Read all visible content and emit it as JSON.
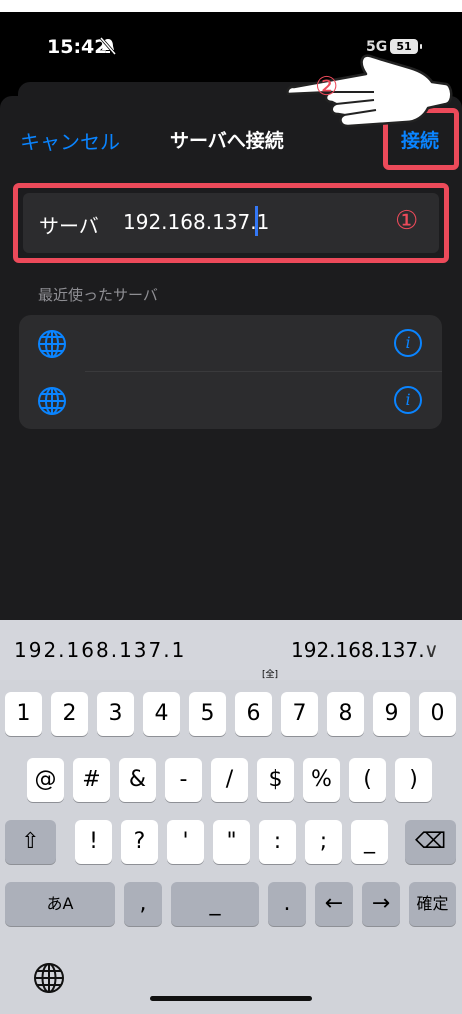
{
  "status_bar": {
    "time": "15:42",
    "network": "5G",
    "battery": "51"
  },
  "header": {
    "cancel_label": "キャンセル",
    "title": "サーバへ接続",
    "connect_label": "接続"
  },
  "server_field": {
    "label": "サーバ",
    "value": "192.168.137.1"
  },
  "recent": {
    "section_label": "最近使ったサーバ",
    "items": [
      {
        "icon": "globe-icon"
      },
      {
        "icon": "globe-icon"
      }
    ]
  },
  "annotations": {
    "step1": "①",
    "step2": "②",
    "highlight_color": "#ec4a5a"
  },
  "keyboard": {
    "candidate_primary": "192.168.137.1",
    "candidate_mark": "[全]",
    "candidate_secondary": "192.168.137.",
    "candidate_more": "∨",
    "row1": [
      "1",
      "2",
      "3",
      "4",
      "5",
      "6",
      "7",
      "8",
      "9",
      "0"
    ],
    "row2": [
      "@",
      "#",
      "&",
      "-",
      "/",
      "$",
      "%",
      "(",
      ")"
    ],
    "row3": [
      "!",
      "?",
      "'",
      "\"",
      ":",
      ";",
      "_"
    ],
    "row4": {
      "kana": "あA",
      "comma": ",",
      "space": "_",
      "period": ".",
      "left": "←",
      "right": "→",
      "confirm": "確定"
    },
    "shift": "⇧",
    "delete": "⌫"
  },
  "colors": {
    "accent": "#0a84ff",
    "sheet_bg": "#1c1c1e",
    "field_bg": "#2c2c2e"
  }
}
